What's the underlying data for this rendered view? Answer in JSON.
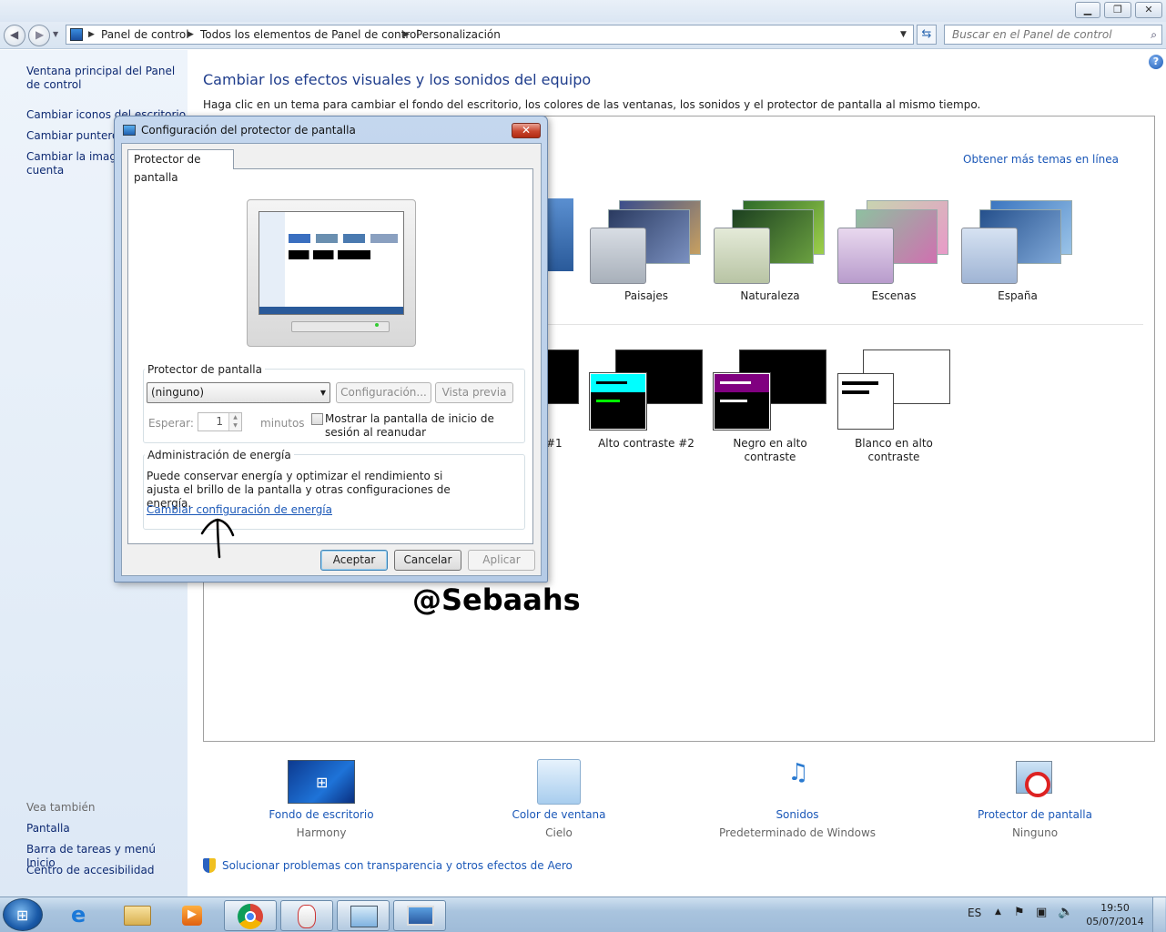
{
  "window": {
    "minimize": "▁",
    "maximize": "❐",
    "close": "✕"
  },
  "address": {
    "seg1": "Panel de control",
    "seg2": "Todos los elementos de Panel de control",
    "seg3": "Personalización",
    "search_placeholder": "Buscar en el Panel de control"
  },
  "sidebar": {
    "items": [
      "Ventana principal del Panel de control",
      "Cambiar iconos del escritorio",
      "Cambiar punteros del mouse",
      "Cambiar la imagen de la cuenta"
    ],
    "see_also_title": "Vea también",
    "see_also": [
      "Pantalla",
      "Barra de tareas y menú Inicio",
      "Centro de accesibilidad"
    ]
  },
  "main": {
    "title": "Cambiar los efectos visuales y los sonidos del equipo",
    "subtitle": "Haga clic en un tema para cambiar el fondo del escritorio, los colores de las ventanas, los sonidos y el protector de pantalla al mismo tiempo.",
    "more_themes": "Obtener más temas en línea",
    "themes": [
      "Paisajes",
      "Naturaleza",
      "Escenas",
      "España"
    ],
    "hc_themes": [
      "#1",
      "Alto contraste #2",
      "Negro en alto contraste",
      "Blanco en alto contraste"
    ],
    "bottom": [
      {
        "title": "Fondo de escritorio",
        "sub": "Harmony"
      },
      {
        "title": "Color de ventana",
        "sub": "Cielo"
      },
      {
        "title": "Sonidos",
        "sub": "Predeterminado de Windows"
      },
      {
        "title": "Protector de pantalla",
        "sub": "Ninguno"
      }
    ],
    "aero_link": "Solucionar problemas con transparencia y otros efectos de Aero"
  },
  "dialog": {
    "title": "Configuración del protector de pantalla",
    "tab": "Protector de pantalla",
    "group1": "Protector de pantalla",
    "select_value": "(ninguno)",
    "settings_btn": "Configuración...",
    "preview_btn": "Vista previa",
    "wait_label": "Esperar:",
    "wait_value": "1",
    "minutes": "minutos",
    "checkbox_label": "Mostrar la pantalla de inicio de sesión al reanudar",
    "group2": "Administración de energía",
    "power_text": "Puede conservar energía y optimizar el rendimiento si ajusta el brillo de la pantalla y otras configuraciones de energía.",
    "power_link": "Cambiar configuración de energía",
    "ok": "Aceptar",
    "cancel": "Cancelar",
    "apply": "Aplicar"
  },
  "watermark": "@Sebaahs",
  "taskbar": {
    "lang": "ES",
    "time": "19:50",
    "date": "05/07/2014"
  },
  "colors": {
    "link": "#1b58b8",
    "heading": "#1f3d8c",
    "hc_cyan": "#00ffff",
    "hc_green": "#00ff00",
    "hc_purple": "#800080"
  }
}
